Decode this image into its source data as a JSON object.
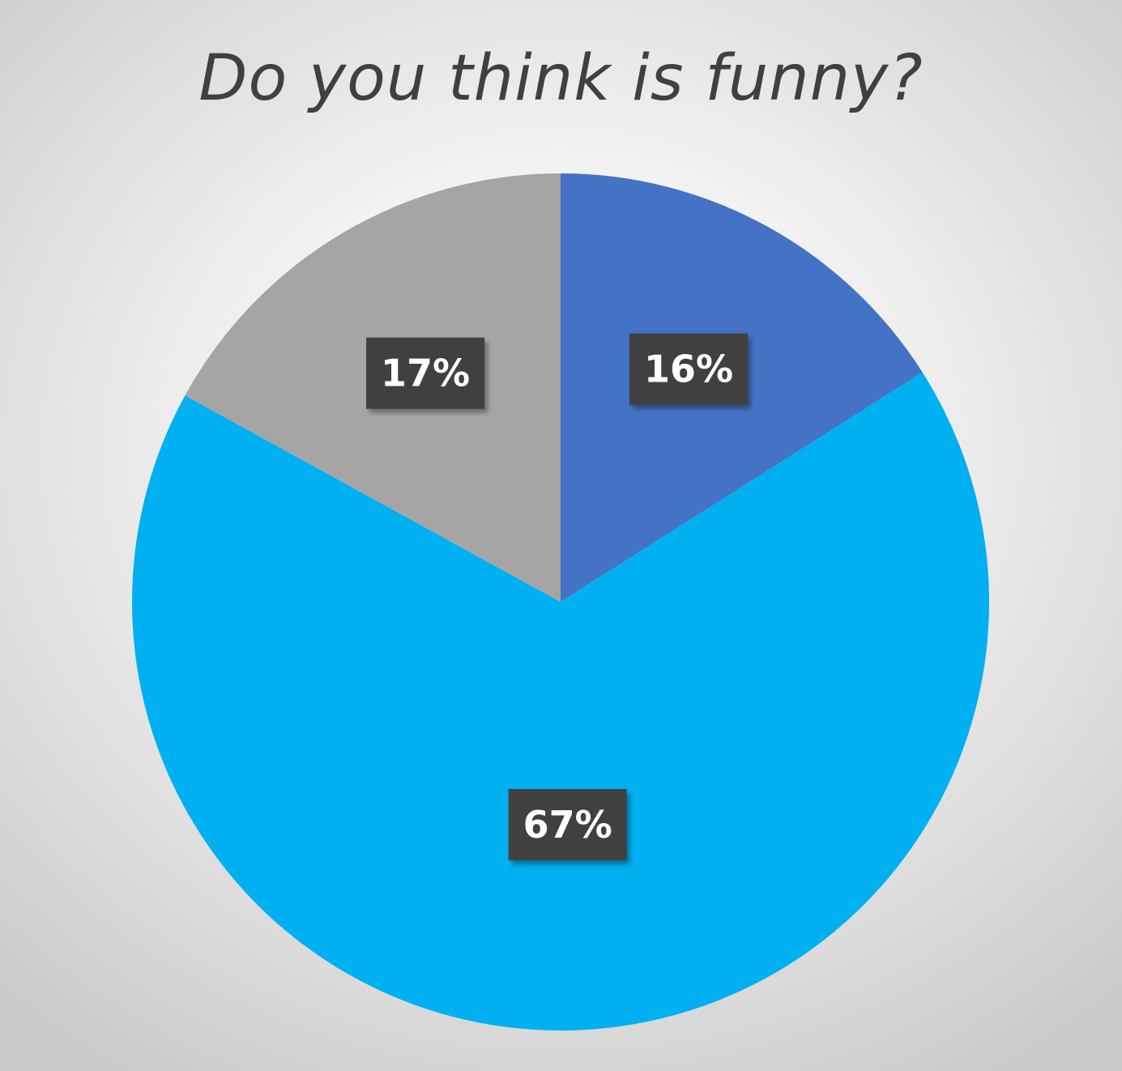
{
  "chart_data": {
    "type": "pie",
    "title": "Do you think is funny?",
    "slices": [
      {
        "value": 16,
        "label": "16%",
        "color": "#4472C4"
      },
      {
        "value": 67,
        "label": "67%",
        "color": "#00B0F0"
      },
      {
        "value": 17,
        "label": "17%",
        "color": "#A5A5A5"
      }
    ],
    "start_angle_deg": 0,
    "direction": "clockwise",
    "data_label_style": {
      "background": "#404040",
      "text_color": "#ffffff"
    }
  }
}
